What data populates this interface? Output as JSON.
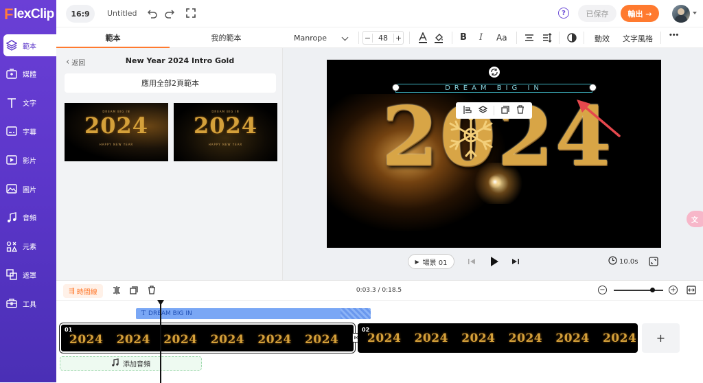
{
  "app": {
    "logo": "FlexClip",
    "logo_prefix": "F",
    "logo_rest": "lexClip"
  },
  "header": {
    "ratio": "16:9",
    "title": "Untitled",
    "help": "?",
    "saved": "已保存",
    "export": "輸出 →"
  },
  "sidebar": {
    "items": [
      {
        "label": "範本",
        "icon": "layers-icon"
      },
      {
        "label": "媒體",
        "icon": "media-icon"
      },
      {
        "label": "文字",
        "icon": "text-icon"
      },
      {
        "label": "字幕",
        "icon": "subtitle-icon"
      },
      {
        "label": "影片",
        "icon": "video-icon"
      },
      {
        "label": "圖片",
        "icon": "image-icon"
      },
      {
        "label": "音頻",
        "icon": "music-icon"
      },
      {
        "label": "元素",
        "icon": "elements-icon"
      },
      {
        "label": "遮罩",
        "icon": "mask-icon"
      },
      {
        "label": "工具",
        "icon": "toolbox-icon"
      }
    ]
  },
  "panel": {
    "tabs": [
      "範本",
      "我的範本"
    ],
    "back": "返回",
    "template_title": "New Year 2024 Intro Gold",
    "apply_all": "應用全部2頁範本",
    "thumb_text": "2024",
    "thumb_sub": "DREAM BIG IN",
    "thumb_foot": "HAPPY NEW YEAR"
  },
  "toolbar": {
    "font": "Manrope",
    "minus": "−",
    "size": "48",
    "plus": "+",
    "bold": "B",
    "italic": "I",
    "case": "Aa",
    "effects": "動效",
    "text_style": "文字風格",
    "more": "•••"
  },
  "canvas": {
    "text_box": "DREAM BIG IN",
    "big_text": "2024"
  },
  "player": {
    "scene": "場景 01",
    "duration": "10.0s"
  },
  "timeline": {
    "label": "時間線",
    "time": "0:03.3 / 0:18.5",
    "zoom_level": 0.78,
    "text_track": "DREAM BIG IN",
    "scene1_num": "01",
    "scene2_num": "02",
    "clip_text": "2024",
    "add_audio": "添加音頻",
    "add_scene": "+"
  },
  "colors": {
    "accent": "#ff7a2f",
    "brand": "#5b36c9",
    "track": "#7aa7f5",
    "selection": "#3fb6c4",
    "arrow": "#e5484d"
  }
}
